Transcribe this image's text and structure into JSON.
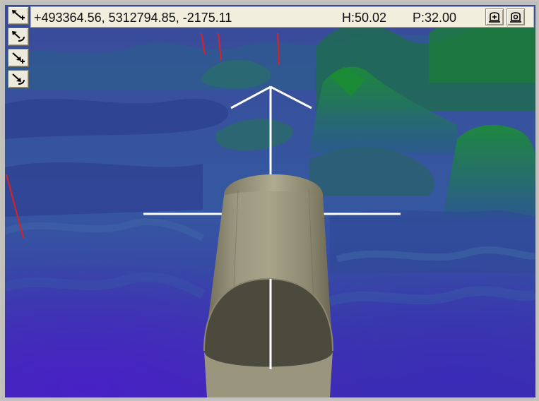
{
  "status": {
    "coordinates": "+493364.56, 5312794.85, -2175.11",
    "heading": "H:50.02",
    "pitch": "P:32.00"
  },
  "toolbar": {
    "icons": [
      "move-forward-up-icon",
      "rotate-up-icon",
      "move-back-down-icon",
      "rotate-down-icon"
    ]
  },
  "status_buttons": {
    "icons": [
      "camera-view-icon",
      "camera-settings-icon"
    ]
  },
  "colors": {
    "terrain_low": "#3a2fb0",
    "terrain_mid": "#3c5fa0",
    "terrain_high": "#1f7a3a",
    "vehicle": "#8e8a72",
    "crosshair": "#ffffff",
    "marker": "#e02020"
  }
}
